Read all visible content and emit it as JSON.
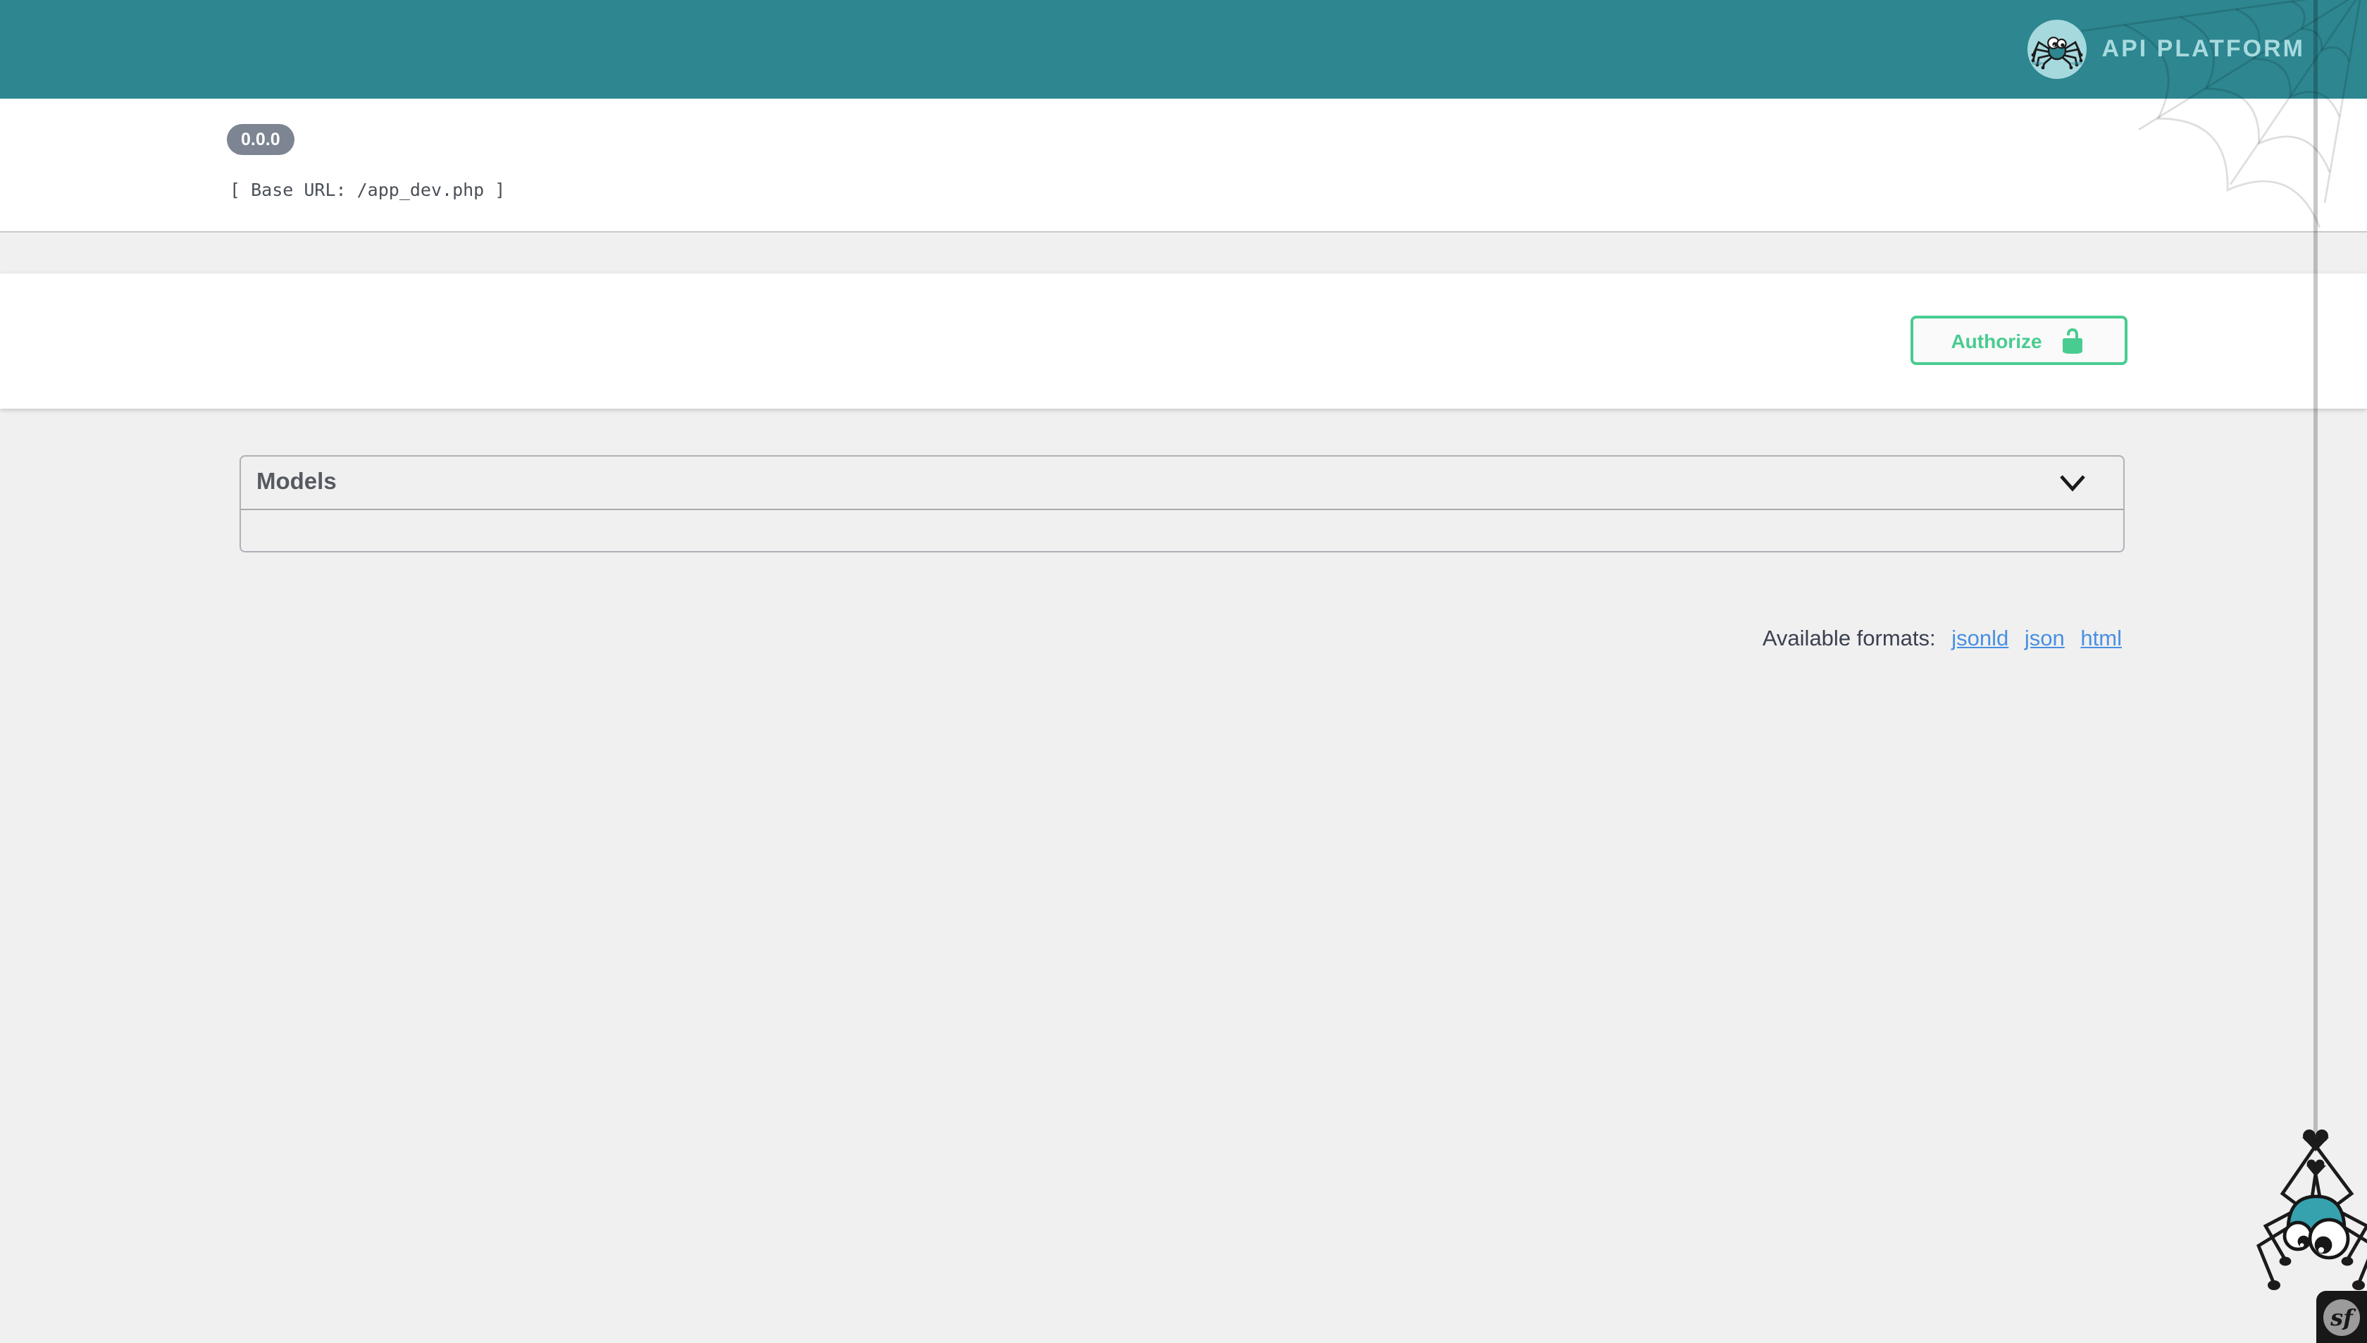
{
  "header": {
    "brand": "API PLATFORM"
  },
  "info": {
    "version": "0.0.0",
    "base_url": "[ Base URL: /app_dev.php ]"
  },
  "scheme": {
    "authorize_label": "Authorize"
  },
  "models": {
    "title": "Models"
  },
  "formats": {
    "label": "Available formats:",
    "links": [
      "jsonld",
      "json",
      "html"
    ]
  },
  "footer": {
    "symfony": "sf"
  },
  "icons": {
    "brand": "spider-logo-icon",
    "authorize": "unlock-icon",
    "models_toggle": "chevron-down-icon",
    "decorations": [
      "spiderweb-icon",
      "spider-thread",
      "hanging-spider-icon",
      "symfony-icon"
    ]
  },
  "colors": {
    "header_teal": "#2d8690",
    "logo_light_teal": "#a5d9de",
    "accent_green": "#49cc90",
    "link_blue": "#4990e2",
    "badge_gray": "#7d8492",
    "text_dark": "#3b4151",
    "page_gray": "#f0f0f0"
  }
}
